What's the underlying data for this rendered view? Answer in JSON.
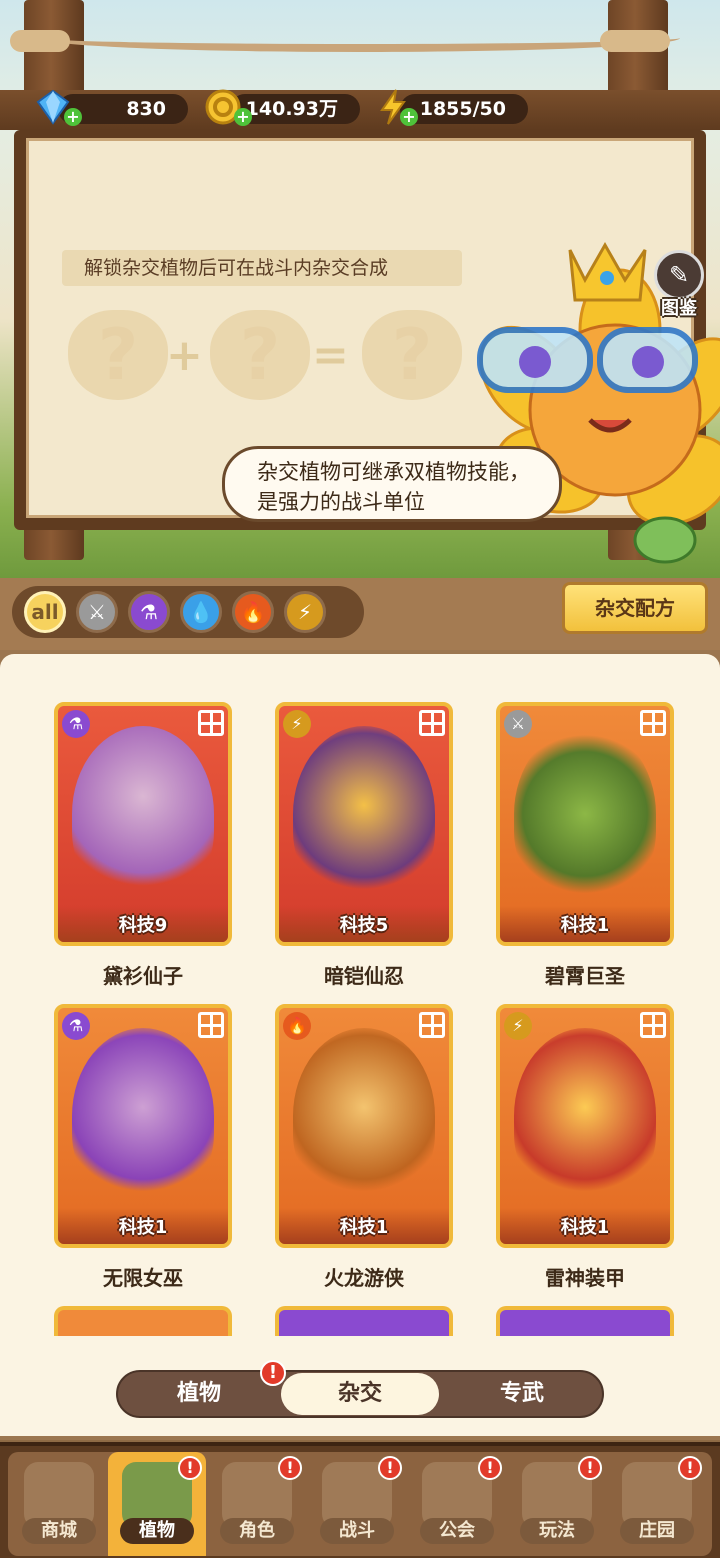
{
  "resources": {
    "gems": "830",
    "coins": "140.93万",
    "energy": "1855/50"
  },
  "hybrid_board": {
    "hint": "解锁杂交植物后可在战斗内杂交合成",
    "question_mark": "?",
    "plus": "+",
    "equals": "=",
    "bubble": "杂交植物可继承双植物技能，是强力的战斗单位",
    "gallery_label": "图鉴"
  },
  "filters": {
    "all_label": "all",
    "items": [
      "sword",
      "potion",
      "water",
      "fire",
      "lightning"
    ],
    "recipe_button": "杂交配方"
  },
  "cards": [
    {
      "name": "黛衫仙子",
      "level": "科技9",
      "element": "potion"
    },
    {
      "name": "暗铠仙忍",
      "level": "科技5",
      "element": "lightning"
    },
    {
      "name": "碧霄巨圣",
      "level": "科技1",
      "element": "sword"
    },
    {
      "name": "无限女巫",
      "level": "科技1",
      "element": "potion"
    },
    {
      "name": "火龙游侠",
      "level": "科技1",
      "element": "fire"
    },
    {
      "name": "雷神装甲",
      "level": "科技1",
      "element": "lightning"
    }
  ],
  "tabs": {
    "items": [
      "植物",
      "杂交",
      "专武"
    ],
    "active": "杂交",
    "badge": "!"
  },
  "bottom_nav": {
    "items": [
      {
        "label": "商城"
      },
      {
        "label": "植物"
      },
      {
        "label": "角色"
      },
      {
        "label": "战斗"
      },
      {
        "label": "公会"
      },
      {
        "label": "玩法"
      },
      {
        "label": "庄园"
      }
    ],
    "active": "植物",
    "badge": "!"
  },
  "colors": {
    "wood_dark": "#5f3b1f",
    "parchment": "#f3e8cd",
    "card_gold": "#f0b93a",
    "alert_red": "#e23a2a",
    "nav_active": "#f3b23a"
  }
}
